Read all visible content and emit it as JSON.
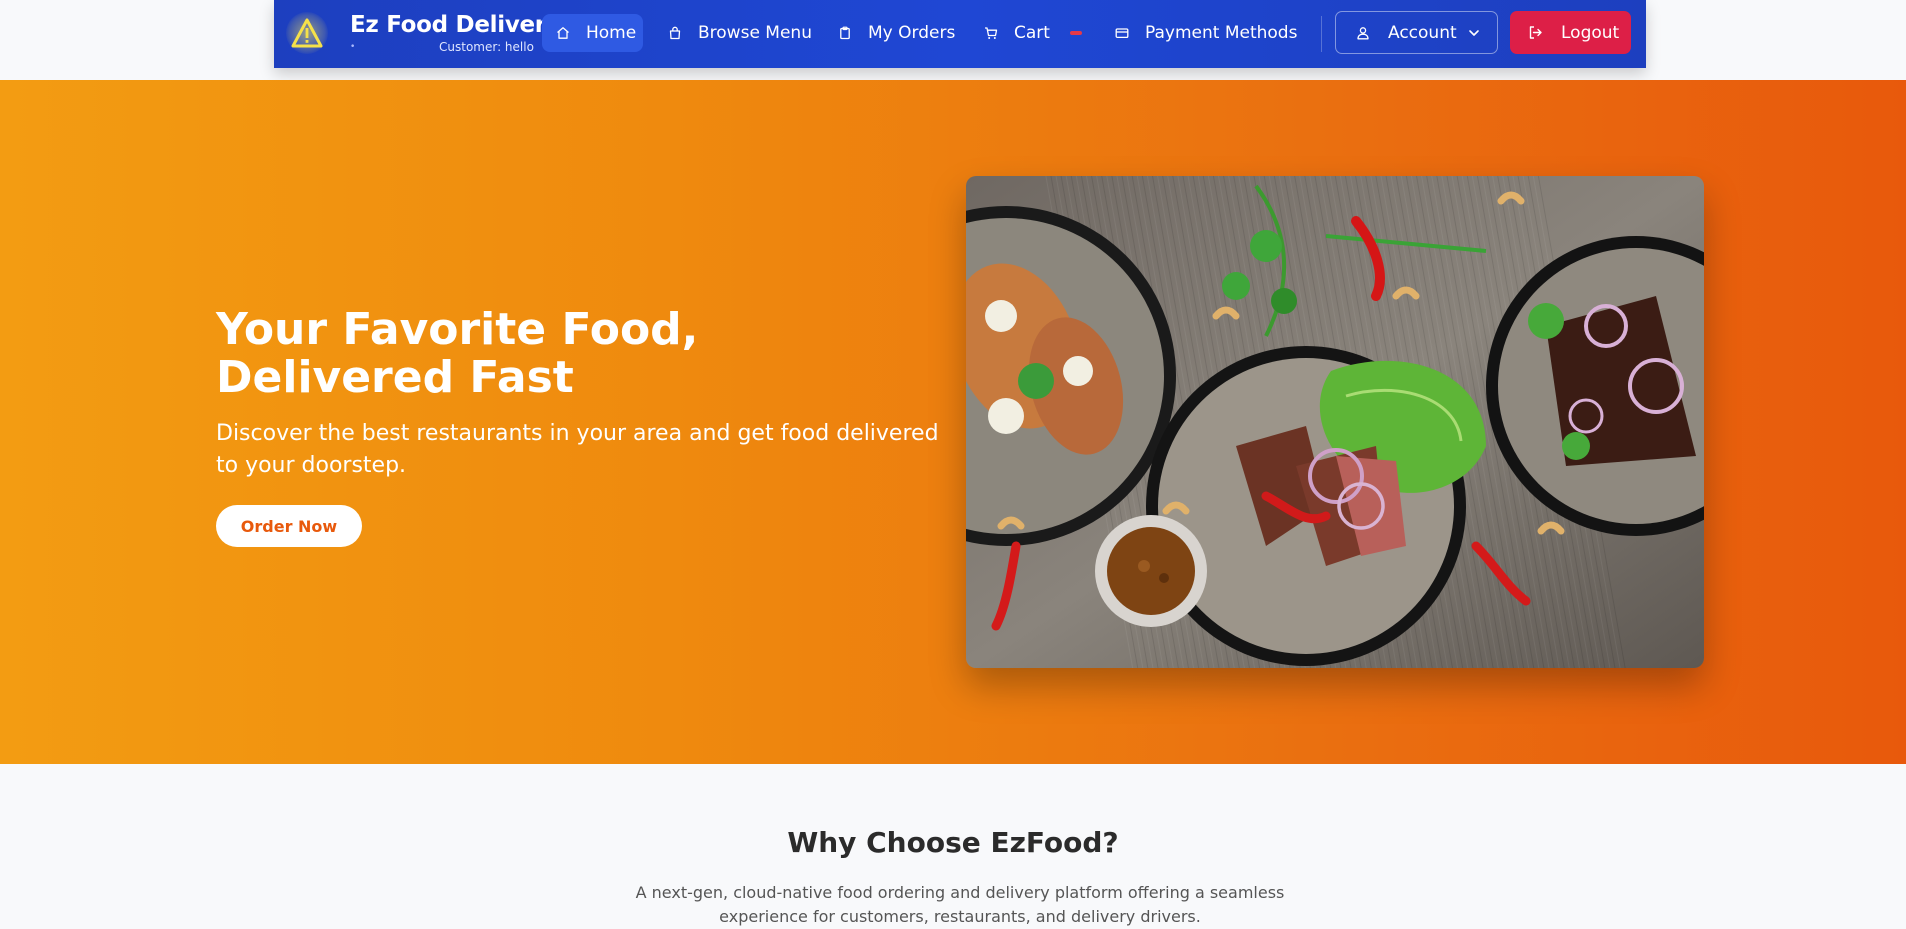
{
  "brand": {
    "title": "Ez Food Delivery",
    "subtitle": "Customer: hello",
    "dot": "•"
  },
  "nav": {
    "items": [
      {
        "label": "Home",
        "icon": "home-icon"
      },
      {
        "label": "Browse Menu",
        "icon": "bag-icon"
      },
      {
        "label": "My Orders",
        "icon": "clipboard-icon"
      },
      {
        "label": "Cart",
        "icon": "cart-icon"
      },
      {
        "label": "Payment Methods",
        "icon": "credit-card-icon"
      }
    ],
    "account_label": "Account",
    "logout_label": "Logout"
  },
  "hero": {
    "title": "Your Favorite Food, Delivered Fast",
    "subtitle": "Discover the best restaurants in your area and get food delivered to your doorstep.",
    "cta_label": "Order Now"
  },
  "why": {
    "title": "Why Choose EzFood?",
    "text": "A next-gen, cloud-native food ordering and delivery platform offering a seamless experience for customers, restaurants, and delivery drivers."
  },
  "colors": {
    "nav_bg": "#1f47d4",
    "nav_active": "#2f5ae3",
    "logout_bg": "#dd1f47",
    "hero_start": "#f39c12",
    "hero_end": "#e8590c",
    "cart_badge": "#e53949"
  }
}
